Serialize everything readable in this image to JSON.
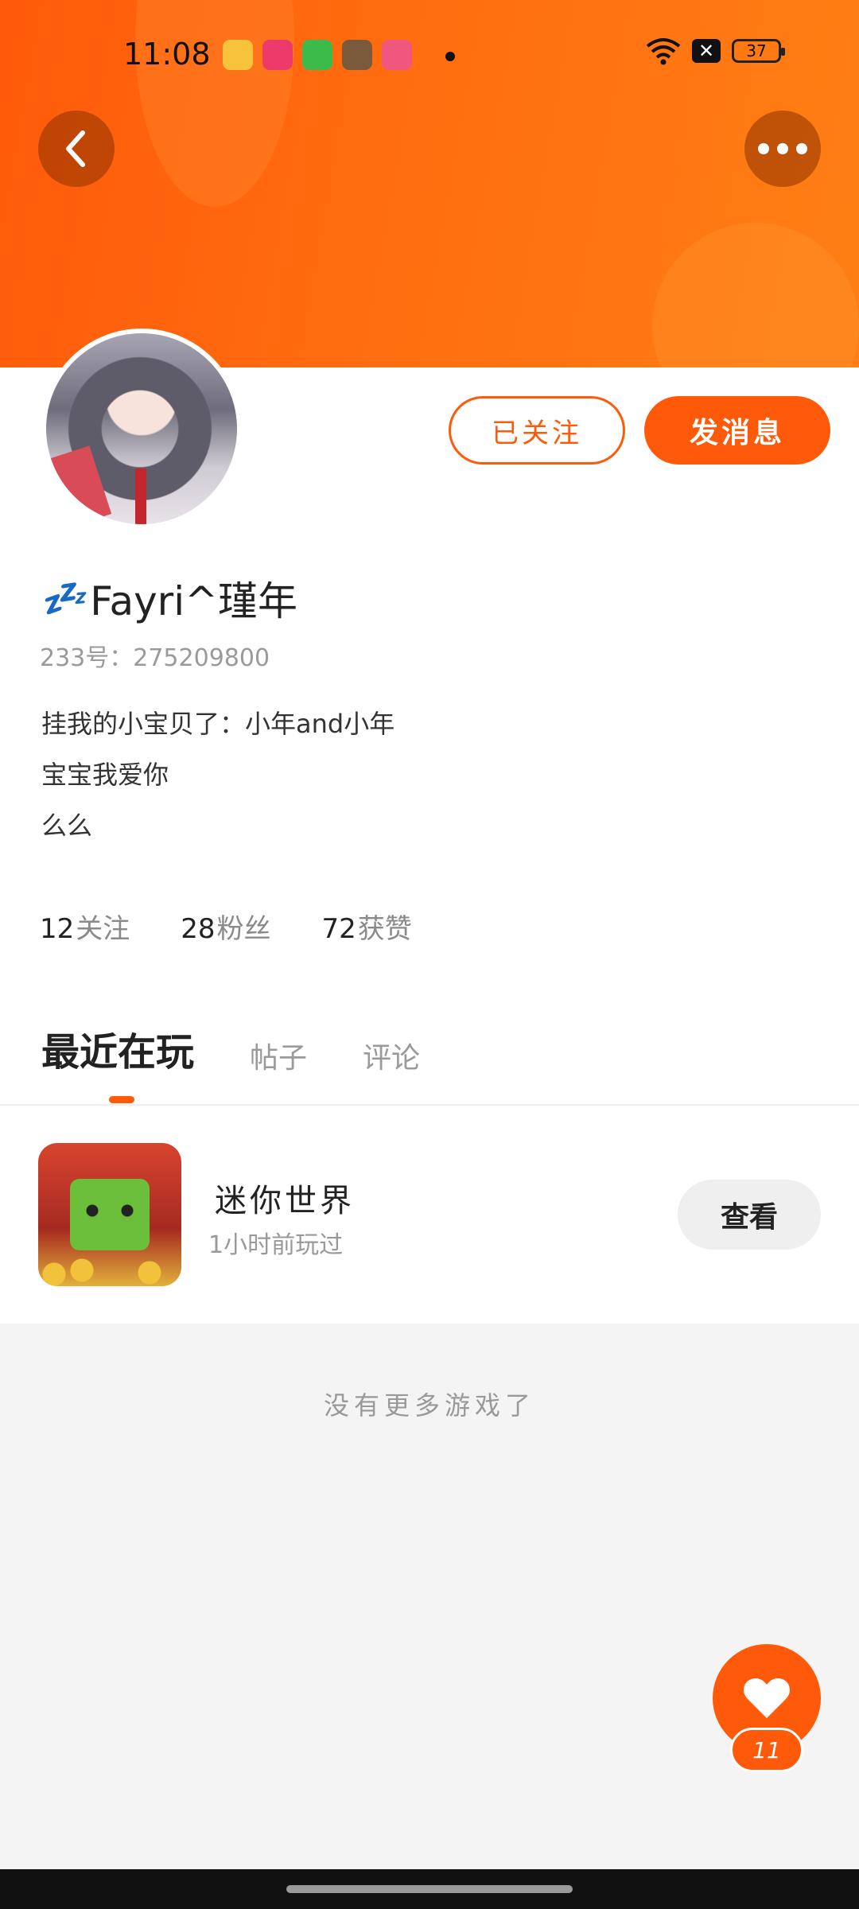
{
  "status_bar": {
    "time": "11:08",
    "battery": "37",
    "app_icons": [
      {
        "name": "notes-app-icon",
        "color": "#f6c33b"
      },
      {
        "name": "video-app-icon",
        "color": "#ee3a6a"
      },
      {
        "name": "shopping-app-icon",
        "color": "#3dbb4a"
      },
      {
        "name": "game-app-icon",
        "color": "#7a5a3a"
      },
      {
        "name": "screen-record-icon",
        "color": "#f0577f"
      }
    ]
  },
  "header": {
    "back_icon": "chevron-left-icon",
    "more_icon": "more-horizontal-icon"
  },
  "profile": {
    "follow_label": "已关注",
    "message_label": "发消息",
    "username_prefix": "💤",
    "username": "Fayri^瑾年",
    "uid_text": "233号：275209800",
    "bio_lines": [
      "挂我的小宝贝了：小年and小年",
      "宝宝我爱你",
      "么么"
    ],
    "stats": [
      {
        "number": "12",
        "label": "关注"
      },
      {
        "number": "28",
        "label": "粉丝"
      },
      {
        "number": "72",
        "label": "获赞"
      }
    ]
  },
  "tabs": [
    {
      "label": "最近在玩",
      "active": true
    },
    {
      "label": "帖子",
      "active": false
    },
    {
      "label": "评论",
      "active": false
    }
  ],
  "games": [
    {
      "name": "迷你世界",
      "played": "1小时前玩过",
      "action": "查看"
    }
  ],
  "footer_text": "没有更多游戏了",
  "like": {
    "count": "11"
  },
  "colors": {
    "accent": "#ff5a0a",
    "header_gradient_end": "#ff7f14"
  }
}
